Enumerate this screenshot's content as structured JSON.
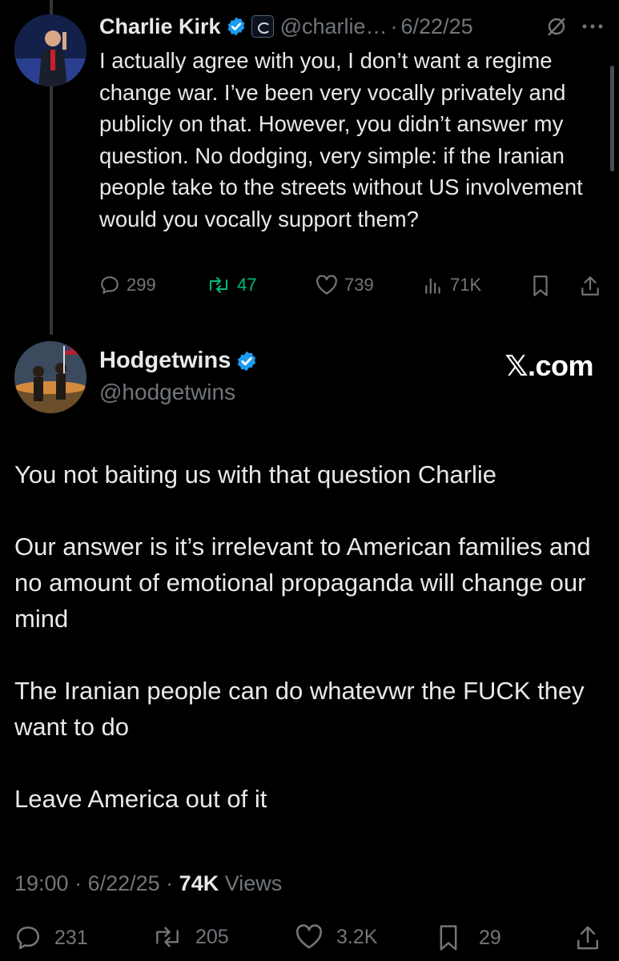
{
  "reply": {
    "name": "Charlie Kirk",
    "handle": "@charlie…",
    "separator": "·",
    "date": "6/22/25",
    "text": "I actually agree with you, I don’t want a regime change war. I’ve been very vocally privately and publicly on that. However, you didn’t answer my question. No dodging, very simple: if the Iranian people take to the streets without US involvement would you vocally support them?",
    "actions": {
      "replies": "299",
      "reposts": "47",
      "likes": "739",
      "views": "71K"
    }
  },
  "main": {
    "name": "Hodgetwins",
    "handle": "@hodgetwins",
    "watermark": "𝕏.com",
    "paragraphs": [
      "You not baiting us with that question Charlie",
      "Our answer is it’s irrelevant to American families and no amount of emotional propaganda will change our mind",
      "The Iranian people can do whatevwr the FUCK they want to do",
      "Leave America out of it"
    ],
    "meta": {
      "time": "19:00",
      "sep1": " · ",
      "date": "6/22/25",
      "sep2": " · ",
      "views_count": "74K",
      "views_label": " Views"
    },
    "actions": {
      "replies": "231",
      "reposts": "205",
      "likes": "3.2K",
      "bookmarks": "29"
    }
  },
  "icons": [
    "reply-icon",
    "repost-icon",
    "like-icon",
    "views-icon",
    "bookmark-icon",
    "share-icon",
    "verified-icon",
    "grok-icon",
    "more-icon"
  ],
  "colors": {
    "background": "#000000",
    "text": "#e7e9ea",
    "secondary": "#71767b",
    "verified": "#1d9bf0",
    "repost": "#00ba7c"
  }
}
